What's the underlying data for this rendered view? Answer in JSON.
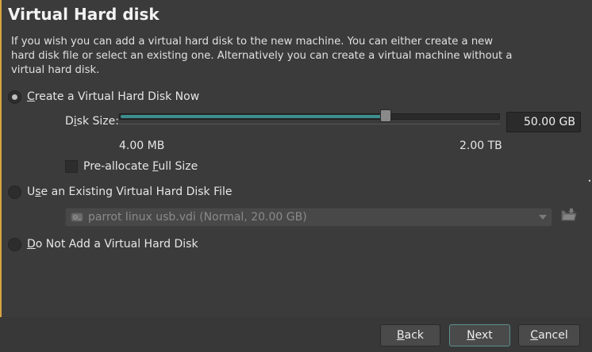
{
  "page": {
    "title": "Virtual Hard disk",
    "description": "If you wish you can add a virtual hard disk to the new machine. You can either create a new hard disk file or select an existing one. Alternatively you can create a virtual machine without a virtual hard disk."
  },
  "options": {
    "create_new": {
      "label_prefix": "",
      "label_mnemonic": "C",
      "label_rest": "reate a Virtual Hard Disk Now",
      "checked": true
    },
    "use_existing": {
      "label_prefix": "U",
      "label_mnemonic": "s",
      "label_rest": "e an Existing Virtual Hard Disk File",
      "checked": false
    },
    "no_disk": {
      "label_prefix": "",
      "label_mnemonic": "D",
      "label_rest": "o Not Add a Virtual Hard Disk",
      "checked": false
    }
  },
  "disk_size": {
    "label_prefix": "D",
    "label_mnemonic": "i",
    "label_rest": "sk Size:",
    "value": "50.00 GB",
    "min_label": "4.00 MB",
    "max_label": "2.00 TB",
    "slider_fraction": 0.7
  },
  "preallocate": {
    "label_prefix": "Pre-allocate ",
    "label_mnemonic": "F",
    "label_rest": "ull Size",
    "checked": false
  },
  "existing_file": {
    "selected": "parrot linux usb.vdi (Normal, 20.00 GB)"
  },
  "buttons": {
    "back": {
      "mnemonic": "B",
      "rest": "ack"
    },
    "next": {
      "mnemonic": "N",
      "rest": "ext"
    },
    "cancel": {
      "mnemonic": "C",
      "rest": "ancel"
    }
  },
  "icons": {
    "disk": "hard-disk-icon",
    "folder": "folder-open-icon"
  },
  "colors": {
    "background": "#3b3b3b",
    "slider_fill": "#3d8e8e",
    "accent_edge": "#d9a441"
  }
}
